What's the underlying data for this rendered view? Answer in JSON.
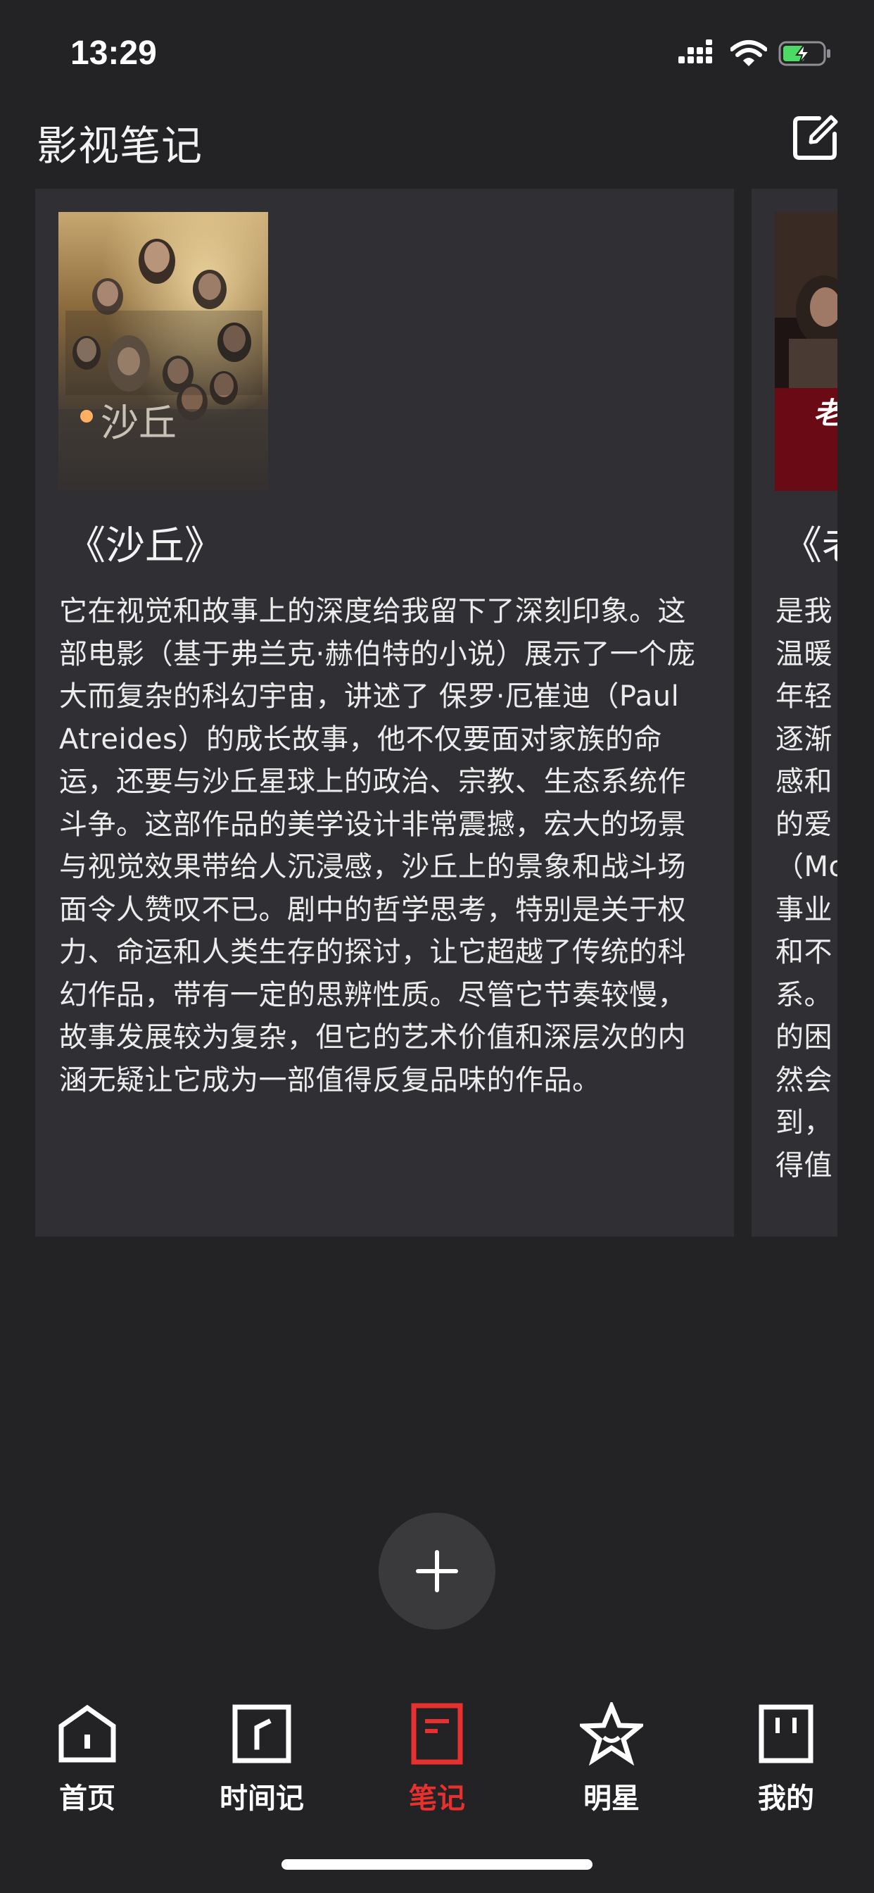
{
  "status_bar": {
    "time": "13:29"
  },
  "header": {
    "title": "影视笔记",
    "edit_icon": "edit-square-icon"
  },
  "notes": [
    {
      "title": "《沙丘》",
      "poster_text": "沙丘",
      "body": "它在视觉和故事上的深度给我留下了深刻印象。这部电影（基于弗兰克·赫伯特的小说）展示了一个庞大而复杂的科幻宇宙，讲述了 保罗·厄崔迪（Paul Atreides）的成长故事，他不仅要面对家族的命运，还要与沙丘星球上的政治、宗教、生态系统作斗争。这部作品的美学设计非常震撼，宏大的场景与视觉效果带给人沉浸感，沙丘上的景象和战斗场面令人赞叹不已。剧中的哲学思考，特别是关于权力、命运和人类生存的探讨，让它超越了传统的科幻作品，带有一定的思辨性质。尽管它节奏较慢，故事发展较为复杂，但它的艺术价值和深层次的内涵无疑让它成为一部值得反复品味的作品。"
    },
    {
      "title": "《老",
      "poster_text": "老",
      "body_lines": [
        "是我",
        "温暖",
        "年轻",
        "逐渐",
        "感和",
        "的爱",
        "（Mo",
        "事业",
        "和不",
        "系。",
        "的困",
        "然会",
        "到，",
        "得值"
      ]
    }
  ],
  "fab": {
    "icon": "plus-icon"
  },
  "tabs": [
    {
      "label": "首页",
      "icon": "home-icon",
      "active": false
    },
    {
      "label": "时间记",
      "icon": "timeline-icon",
      "active": false
    },
    {
      "label": "笔记",
      "icon": "note-icon",
      "active": true
    },
    {
      "label": "明星",
      "icon": "star-icon",
      "active": false
    },
    {
      "label": "我的",
      "icon": "profile-icon",
      "active": false
    }
  ],
  "colors": {
    "background": "#232325",
    "card": "#302f34",
    "accent": "#e8312f",
    "battery": "#4cd964"
  }
}
